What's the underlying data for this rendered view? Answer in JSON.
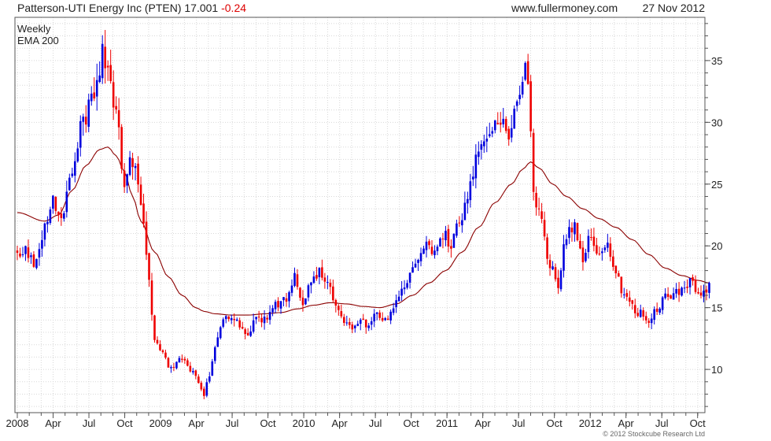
{
  "header": {
    "title": "Patterson-UTI Energy Inc (PTEN) 17.001",
    "change": "-0.24",
    "site": "www.fullermoney.com",
    "date": "27 Nov 2012"
  },
  "legend": {
    "weekly": "Weekly",
    "ema": "EMA 200"
  },
  "copyright": "© 2012 Stockcube Research Ltd",
  "colors": {
    "up": "#0000dd",
    "down": "#ee0000",
    "ema": "#8b0000",
    "grid": "#d8d8d8",
    "change": "#dd0000"
  },
  "chart_data": {
    "type": "candlestick",
    "x_ticks": [
      "2008",
      "Apr",
      "Jul",
      "Oct",
      "2009",
      "Apr",
      "Jul",
      "Oct",
      "2010",
      "Apr",
      "Jul",
      "Oct",
      "2011",
      "Apr",
      "Jul",
      "Oct",
      "2012",
      "Apr",
      "Jul",
      "Oct"
    ],
    "y_ticks": [
      10,
      15,
      20,
      25,
      30,
      35
    ],
    "ylim": [
      6.5,
      38.5
    ],
    "price_anchors": [
      [
        0,
        19.5
      ],
      [
        4,
        19.5
      ],
      [
        7,
        18.5
      ],
      [
        10,
        21.5
      ],
      [
        13,
        23.5
      ],
      [
        16,
        22.5
      ],
      [
        20,
        26
      ],
      [
        24,
        30
      ],
      [
        27,
        32
      ],
      [
        30,
        34
      ],
      [
        31,
        36.5
      ],
      [
        33,
        34
      ],
      [
        36,
        31
      ],
      [
        39,
        25
      ],
      [
        41,
        27.5
      ],
      [
        43,
        26.5
      ],
      [
        46,
        22
      ],
      [
        48,
        17
      ],
      [
        50,
        12.5
      ],
      [
        53,
        11.5
      ],
      [
        56,
        10
      ],
      [
        60,
        11
      ],
      [
        63,
        10
      ],
      [
        66,
        9
      ],
      [
        68,
        8
      ],
      [
        70,
        9.5
      ],
      [
        72,
        12
      ],
      [
        75,
        14
      ],
      [
        78,
        14.5
      ],
      [
        81,
        13.5
      ],
      [
        84,
        13
      ],
      [
        87,
        14
      ],
      [
        90,
        14
      ],
      [
        93,
        15
      ],
      [
        96,
        15.5
      ],
      [
        99,
        16
      ],
      [
        101,
        17.5
      ],
      [
        104,
        15
      ],
      [
        107,
        17
      ],
      [
        110,
        18
      ],
      [
        113,
        17
      ],
      [
        116,
        15.5
      ],
      [
        119,
        14
      ],
      [
        122,
        13.5
      ],
      [
        125,
        14
      ],
      [
        128,
        13.5
      ],
      [
        131,
        14.5
      ],
      [
        134,
        14
      ],
      [
        137,
        15
      ],
      [
        140,
        16.5
      ],
      [
        143,
        17.5
      ],
      [
        146,
        19
      ],
      [
        149,
        20
      ],
      [
        152,
        19.5
      ],
      [
        155,
        21
      ],
      [
        158,
        20
      ],
      [
        161,
        22
      ],
      [
        164,
        24
      ],
      [
        167,
        27
      ],
      [
        170,
        28
      ],
      [
        173,
        30
      ],
      [
        176,
        30.5
      ],
      [
        179,
        28
      ],
      [
        182,
        32
      ],
      [
        185,
        34
      ],
      [
        186,
        33.5
      ],
      [
        187,
        30
      ],
      [
        188,
        24
      ],
      [
        191,
        22
      ],
      [
        194,
        18.5
      ],
      [
        197,
        17
      ],
      [
        200,
        21
      ],
      [
        203,
        21.5
      ],
      [
        206,
        19
      ],
      [
        209,
        21
      ],
      [
        212,
        19
      ],
      [
        215,
        20
      ],
      [
        218,
        18
      ],
      [
        221,
        16
      ],
      [
        224,
        15
      ],
      [
        227,
        14.5
      ],
      [
        230,
        14
      ],
      [
        233,
        15
      ],
      [
        236,
        16
      ],
      [
        239,
        16
      ],
      [
        242,
        16.5
      ],
      [
        245,
        17
      ],
      [
        248,
        16.5
      ],
      [
        251,
        16
      ],
      [
        252,
        17
      ]
    ],
    "ema_anchors": [
      [
        0,
        22.7
      ],
      [
        10,
        22
      ],
      [
        15,
        22.5
      ],
      [
        20,
        24.5
      ],
      [
        25,
        26.5
      ],
      [
        30,
        27.8
      ],
      [
        33,
        28
      ],
      [
        36,
        27.3
      ],
      [
        39,
        26
      ],
      [
        42,
        24
      ],
      [
        45,
        22
      ],
      [
        50,
        19.5
      ],
      [
        55,
        17.5
      ],
      [
        60,
        16
      ],
      [
        65,
        15
      ],
      [
        68,
        14.7
      ],
      [
        72,
        14.5
      ],
      [
        78,
        14.4
      ],
      [
        84,
        14.4
      ],
      [
        90,
        14.5
      ],
      [
        96,
        14.6
      ],
      [
        102,
        14.9
      ],
      [
        108,
        15.2
      ],
      [
        114,
        15.4
      ],
      [
        120,
        15.3
      ],
      [
        126,
        15.1
      ],
      [
        132,
        15
      ],
      [
        138,
        15.3
      ],
      [
        144,
        16
      ],
      [
        150,
        17
      ],
      [
        156,
        18
      ],
      [
        162,
        19.5
      ],
      [
        168,
        21.5
      ],
      [
        174,
        23.5
      ],
      [
        180,
        25
      ],
      [
        184,
        26.2
      ],
      [
        187,
        26.8
      ],
      [
        190,
        26.3
      ],
      [
        195,
        25
      ],
      [
        200,
        24
      ],
      [
        206,
        23
      ],
      [
        212,
        22.2
      ],
      [
        218,
        21.5
      ],
      [
        224,
        20.5
      ],
      [
        230,
        19.3
      ],
      [
        236,
        18.2
      ],
      [
        242,
        17.6
      ],
      [
        248,
        17.2
      ],
      [
        252,
        17
      ]
    ],
    "last_close": 17.001,
    "change": -0.24
  }
}
